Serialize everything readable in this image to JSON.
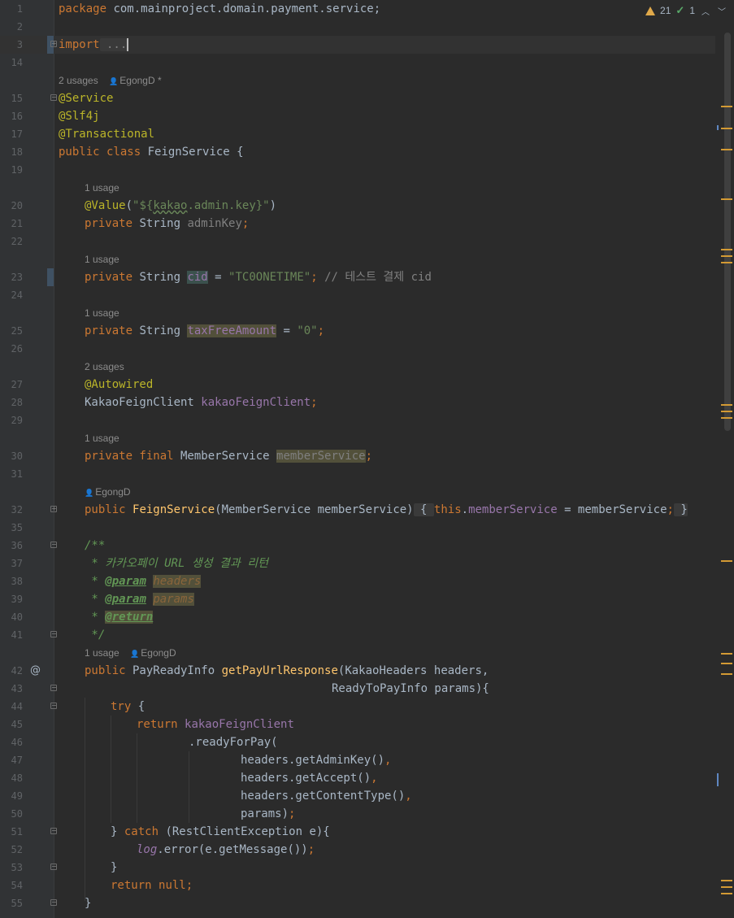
{
  "inspections": {
    "warnings": "21",
    "weak_warnings": "1"
  },
  "colors": {
    "background": "#2b2b2b",
    "keyword": "#cc7832",
    "annotation": "#bbb529",
    "string": "#6a8759",
    "field": "#9876aa",
    "method": "#ffc66d",
    "warning_stripe": "#d39a34"
  },
  "hints": {
    "h14": {
      "usages": "2 usages",
      "author": "EgongD *"
    },
    "h19": {
      "usages": "1 usage"
    },
    "h22": {
      "usages": "1 usage"
    },
    "h24": {
      "usages": "1 usage"
    },
    "h26": {
      "usages": "2 usages"
    },
    "h29": {
      "usages": "1 usage"
    },
    "h31": {
      "author": "EgongD"
    },
    "h41": {
      "usages": "1 usage",
      "author": "EgongD"
    }
  },
  "lines": {
    "l1": [
      "package",
      " com.mainproject.domain.payment.service;"
    ],
    "l3": [
      "import",
      " ..."
    ],
    "l15": [
      "@Service"
    ],
    "l16": [
      "@Slf4j"
    ],
    "l17": [
      "@Transactional"
    ],
    "l18": [
      "public class",
      " FeignService {"
    ],
    "l20": [
      "@Value",
      "(",
      "\"${",
      "kakao",
      ".admin.key}\"",
      ")"
    ],
    "l21": [
      "private",
      " String ",
      "adminKey",
      ";"
    ],
    "l23": [
      "private",
      " String ",
      "cid",
      " = ",
      "\"TC0ONETIME\"",
      ";",
      " // 테스트 결제 cid"
    ],
    "l25": [
      "private",
      " String ",
      "taxFreeAmount",
      " = ",
      "\"0\"",
      ";"
    ],
    "l27": [
      "@Autowired"
    ],
    "l28": [
      "KakaoFeignClient ",
      "kakaoFeignClient",
      ";"
    ],
    "l30": [
      "private final",
      " MemberService ",
      "memberService",
      ";"
    ],
    "l32": [
      "public",
      " ",
      "FeignService",
      "(MemberService memberService)",
      " { ",
      "this",
      ".",
      "memberService",
      " = memberService",
      ";",
      " }"
    ],
    "l36": [
      "/**"
    ],
    "l37": [
      " * 카카오페이 ",
      "URL",
      " 생성 결과 리턴"
    ],
    "l38": [
      " * ",
      "@param",
      " ",
      "headers"
    ],
    "l39": [
      " * ",
      "@param",
      " ",
      "params"
    ],
    "l40": [
      " * ",
      "@return"
    ],
    "l41": [
      " */"
    ],
    "l42": [
      "public",
      " PayReadyInfo ",
      "getPayUrlResponse",
      "(KakaoHeaders headers,"
    ],
    "l43": [
      "ReadyToPayInfo params){"
    ],
    "l44": [
      "try",
      " {"
    ],
    "l45": [
      "return",
      " ",
      "kakaoFeignClient"
    ],
    "l46": [
      ".readyForPay("
    ],
    "l47": [
      "headers.getAdminKey()",
      ","
    ],
    "l48": [
      "headers.getAccept()",
      ","
    ],
    "l49": [
      "headers.getContentType()",
      ","
    ],
    "l50": [
      "params)",
      ";"
    ],
    "l51": [
      "} ",
      "catch",
      " (RestClientException e){"
    ],
    "l52": [
      "log",
      ".error(e.getMessage())",
      ";"
    ],
    "l53": [
      "}"
    ],
    "l54": [
      "return",
      " ",
      "null",
      ";"
    ],
    "l55": [
      "}"
    ]
  }
}
